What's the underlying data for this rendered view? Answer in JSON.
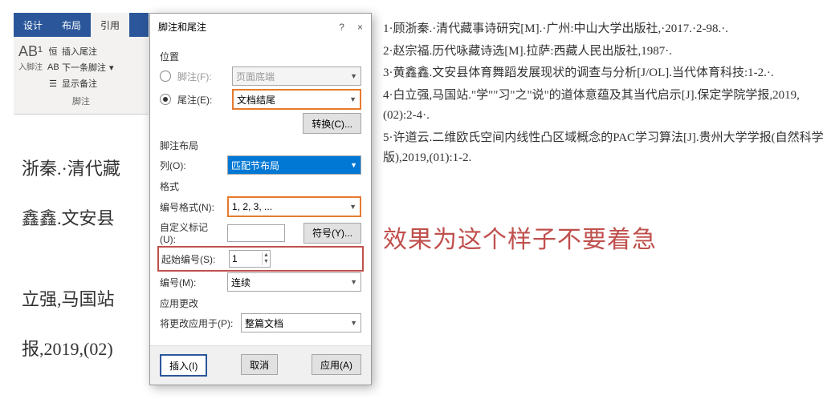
{
  "ribbon": {
    "tabs": [
      "设计",
      "布局",
      "引用"
    ],
    "active_tab": 2,
    "big_btn": "AB¹",
    "big_btn_sub": "入脚注",
    "items": [
      "插入尾注",
      "下一条脚注",
      "显示备注"
    ],
    "group_label": "脚注"
  },
  "doc_lines": [
    "浙秦.·清代藏",
    "鑫鑫.文安县",
    "",
    "立强,马国站",
    "报,2019,(02)"
  ],
  "dialog": {
    "title": "脚注和尾注",
    "help": "?",
    "close": "×",
    "sec_position": "位置",
    "footnote_label": "脚注(F):",
    "footnote_value": "页面底端",
    "endnote_label": "尾注(E):",
    "endnote_value": "文档结尾",
    "convert_btn": "转换(C)...",
    "sec_layout": "脚注布局",
    "columns_label": "列(O):",
    "columns_value": "匹配节布局",
    "sec_format": "格式",
    "numfmt_label": "编号格式(N):",
    "numfmt_value": "1, 2, 3, ...",
    "custom_label": "自定义标记(U):",
    "custom_value": "",
    "symbol_btn": "符号(Y)...",
    "start_label": "起始编号(S):",
    "start_value": "1",
    "numbering_label": "编号(M):",
    "numbering_value": "连续",
    "sec_apply": "应用更改",
    "applyto_label": "将更改应用于(P):",
    "applyto_value": "整篇文档",
    "insert_btn": "插入(I)",
    "cancel_btn": "取消",
    "apply_btn": "应用(A)"
  },
  "references": [
    "1·顾浙秦.·清代藏事诗研究[M].·广州:中山大学出版社,·2017.·2-98.·.",
    "2·赵宗福.历代咏藏诗选[M].拉萨:西藏人民出版社,1987·.",
    "3·黄鑫鑫.文安县体育舞蹈发展现状的调查与分析[J/OL].当代体育科技:1-2.·.",
    "4·白立强,马国站.\"学\"\"习\"之\"说\"的道体意蕴及其当代启示[J].保定学院学报,2019,(02):2-4·.",
    "5·许道云.二维欧氏空间内线性凸区域概念的PAC学习算法[J].贵州大学学报(自然科学版),2019,(01):1-2."
  ],
  "callout": "效果为这个样子不要着急"
}
